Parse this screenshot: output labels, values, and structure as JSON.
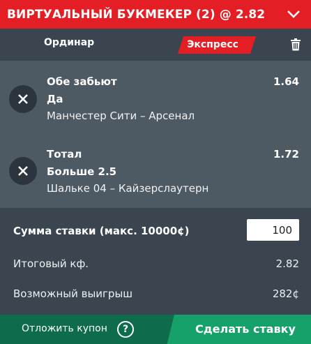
{
  "header": {
    "title": "ВИРТУАЛЬНЫЙ БУКМЕКЕР (2) @ 2.82"
  },
  "tabs": {
    "single": "Ординар",
    "express": "Экспресс",
    "active": "express"
  },
  "bets": [
    {
      "market": "Обе забьют",
      "outcome": "Да",
      "event": "Манчестер Сити – Арсенал",
      "odds": "1.64"
    },
    {
      "market": "Тотал",
      "outcome": "Больше 2.5",
      "event": "Шальке 04 – Кайзерслаутерн",
      "odds": "1.72"
    }
  ],
  "summary": {
    "stake_label": "Сумма ставки (макс. 10000¢)",
    "stake_value": "100",
    "total_odds_label": "Итоговый кф.",
    "total_odds_value": "2.82",
    "win_label": "Возможный выигрыш",
    "win_value": "282¢"
  },
  "footer": {
    "postpone": "Отложить купон",
    "help": "?",
    "place_bet": "Сделать ставку"
  },
  "colors": {
    "brand_red": "#e31e24",
    "panel_dark": "#3a4550",
    "panel_light": "#4d5963",
    "footer_green": "#0e6b4c",
    "button_green": "#16a06a"
  }
}
